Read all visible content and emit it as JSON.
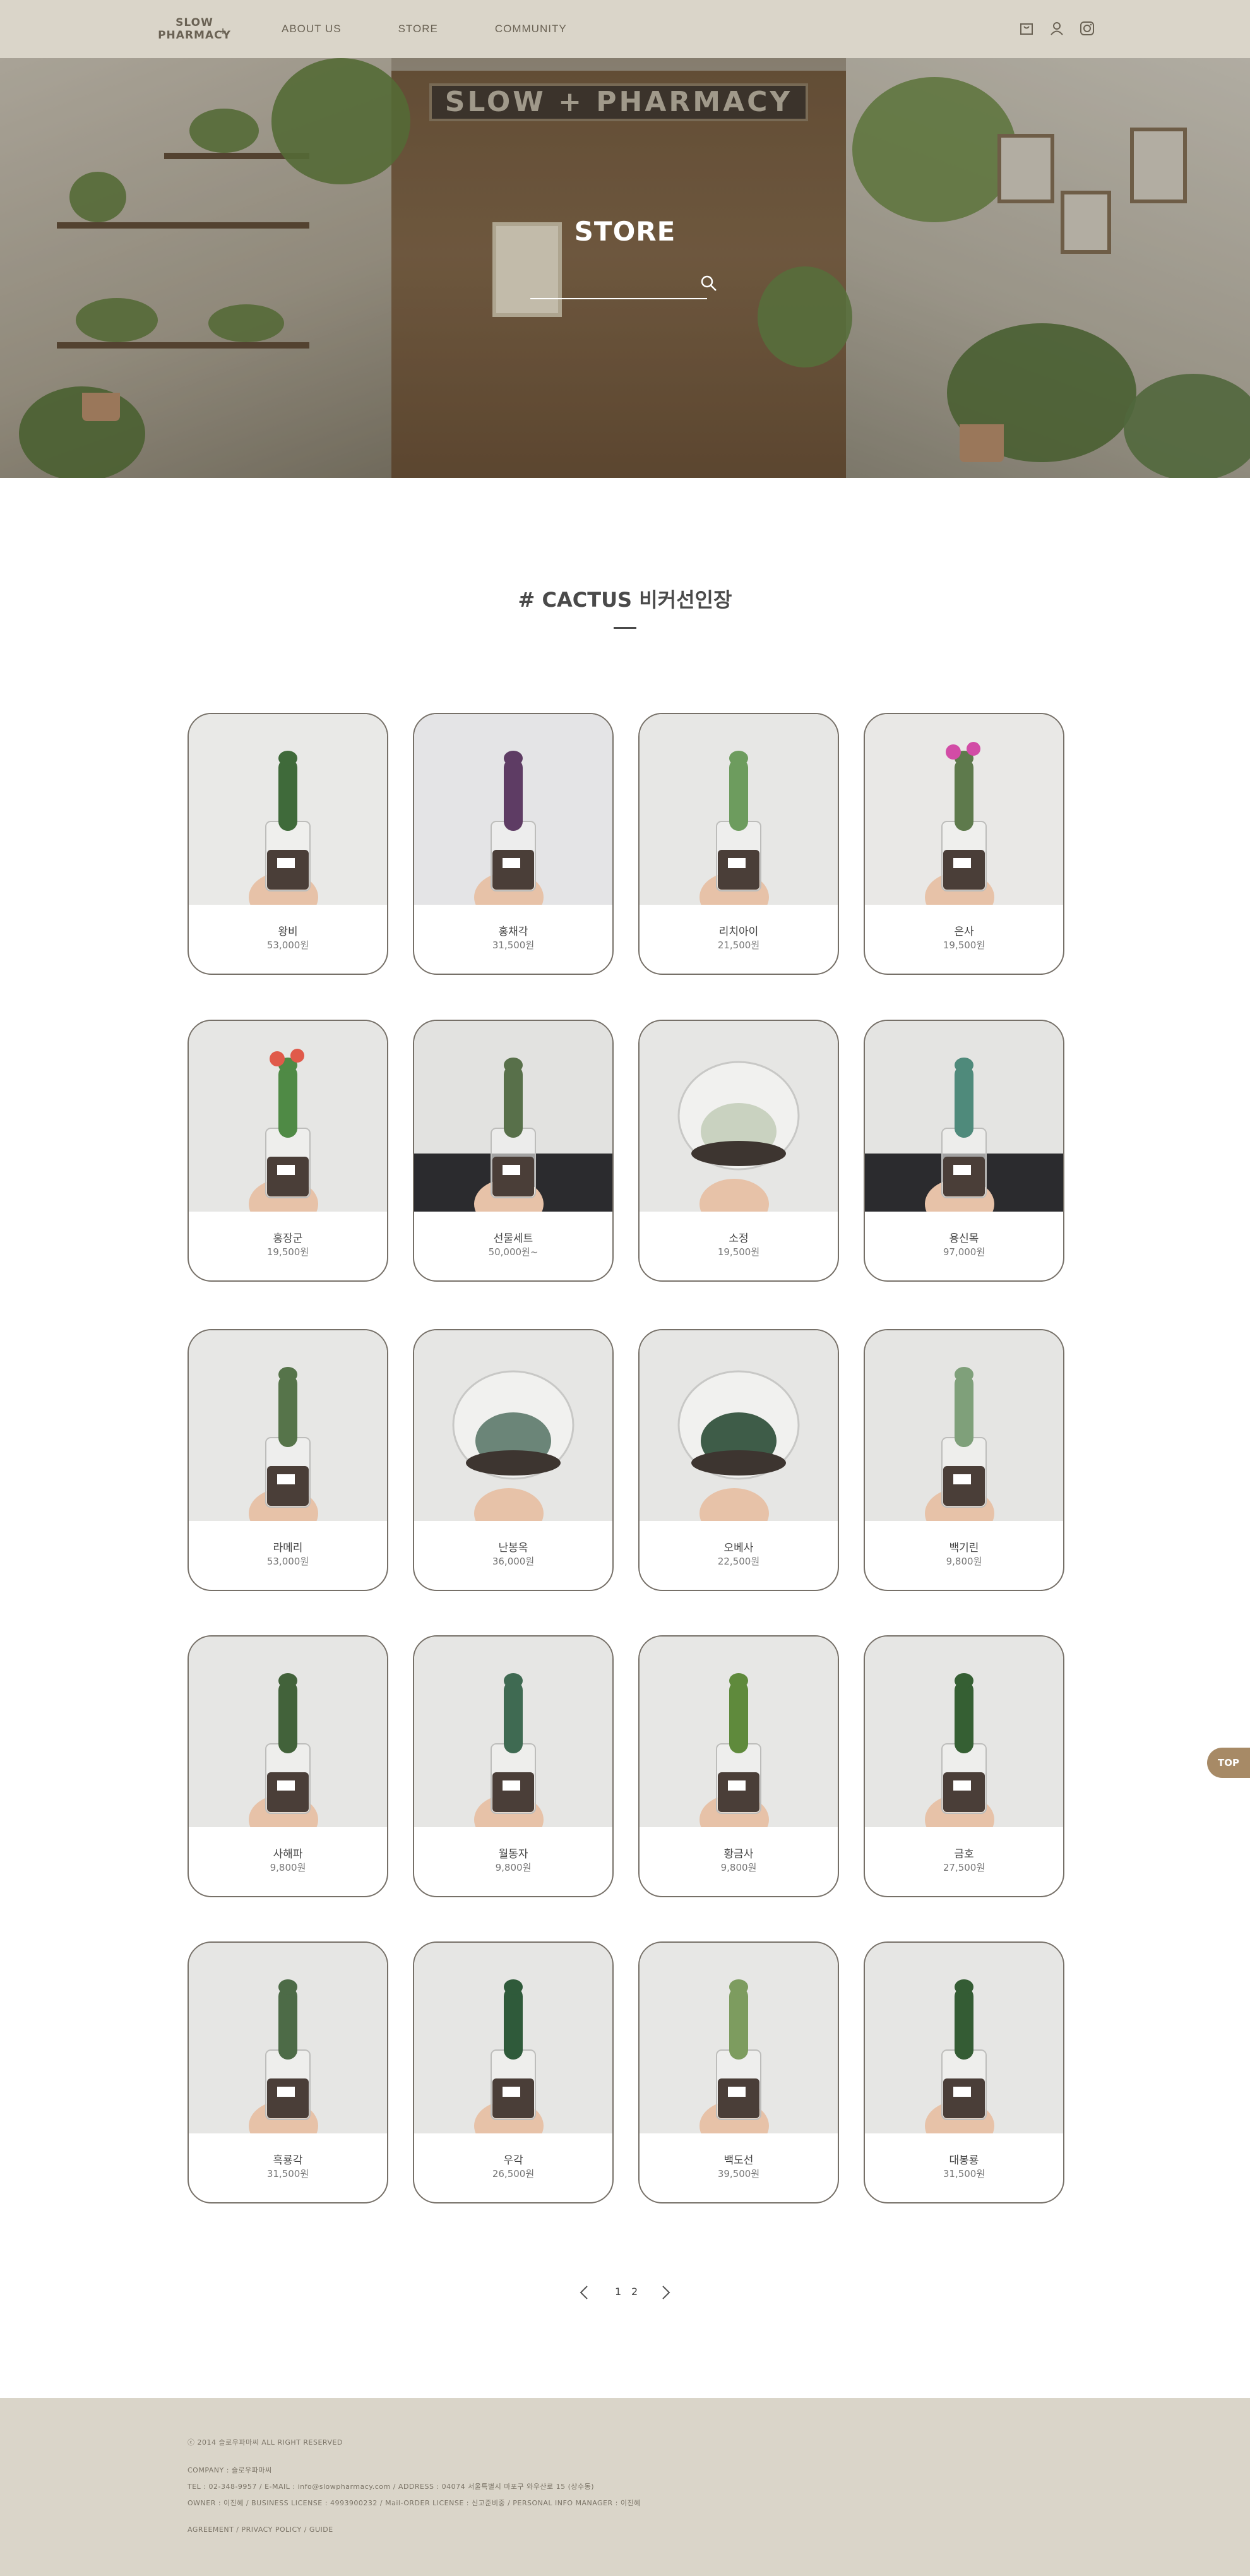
{
  "header": {
    "logo": {
      "line1": "SLOW",
      "line2": "PHARMACY",
      "mark": "+"
    },
    "nav": [
      {
        "label": "ABOUT US"
      },
      {
        "label": "STORE"
      },
      {
        "label": "COMMUNITY"
      }
    ],
    "icons": [
      "bag-icon",
      "user-icon",
      "instagram-icon"
    ]
  },
  "hero": {
    "sign": "SLOW + PHARMACY",
    "title": "STORE",
    "search_placeholder": ""
  },
  "section": {
    "title": "# CACTUS 비커선인장"
  },
  "products": [
    {
      "name": "왕비",
      "price": "53,000원"
    },
    {
      "name": "홍채각",
      "price": "31,500원"
    },
    {
      "name": "리치아이",
      "price": "21,500원"
    },
    {
      "name": "은사",
      "price": "19,500원"
    },
    {
      "name": "홍장군",
      "price": "19,500원"
    },
    {
      "name": "선물세트",
      "price": "50,000원~"
    },
    {
      "name": "소정",
      "price": "19,500원"
    },
    {
      "name": "용신목",
      "price": "97,000원"
    },
    {
      "name": "라메리",
      "price": "53,000원"
    },
    {
      "name": "난봉옥",
      "price": "36,000원"
    },
    {
      "name": "오베사",
      "price": "22,500원"
    },
    {
      "name": "백기린",
      "price": "9,800원"
    },
    {
      "name": "사해파",
      "price": "9,800원"
    },
    {
      "name": "월동자",
      "price": "9,800원"
    },
    {
      "name": "황금사",
      "price": "9,800원"
    },
    {
      "name": "금호",
      "price": "27,500원"
    },
    {
      "name": "흑룡각",
      "price": "31,500원"
    },
    {
      "name": "우각",
      "price": "26,500원"
    },
    {
      "name": "백도선",
      "price": "39,500원"
    },
    {
      "name": "대봉룡",
      "price": "31,500원"
    }
  ],
  "pagination": {
    "pages": [
      "1",
      "2"
    ]
  },
  "top_button": "TOP",
  "footer": {
    "copyright": "ⓒ 2014 슬로우파마씨 ALL RIGHT RESERVED",
    "company": "COMPANY : 슬로우파마씨",
    "contact": "TEL : 02-348-9957 / E-MAIL : info@slowpharmacy.com / ADDRESS : 04074 서울특별시 마포구 와우산로 15 (상수동)",
    "owner": "OWNER : 이진혜 / BUSINESS LICENSE : 4993900232 / Mail-ORDER LICENSE : 신고준비중 / PERSONAL INFO MANAGER : 이진혜",
    "links": "AGREEMENT / PRIVACY POLICY / GUIDE"
  },
  "colors": {
    "header_bg": "#dad5c9",
    "footer_bg": "#dad5c9",
    "card_border": "#767068",
    "top_button": "#a78a66"
  }
}
